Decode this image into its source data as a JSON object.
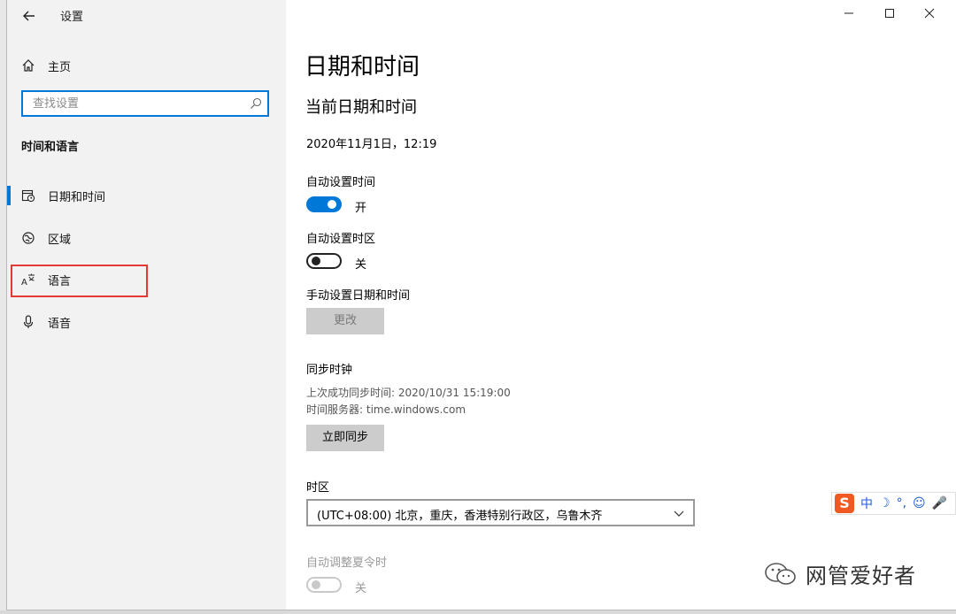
{
  "window": {
    "app_title": "设置",
    "controls": {
      "minimize": "—",
      "maximize": "☐",
      "close": "✕"
    }
  },
  "sidebar": {
    "home_label": "主页",
    "search_placeholder": "查找设置",
    "section_title": "时间和语言",
    "items": [
      {
        "label": "日期和时间",
        "icon": "calendar-clock-icon",
        "active": true
      },
      {
        "label": "区域",
        "icon": "globe-region-icon",
        "active": false
      },
      {
        "label": "语言",
        "icon": "language-icon",
        "active": false
      },
      {
        "label": "语音",
        "icon": "microphone-icon",
        "active": false
      }
    ]
  },
  "main": {
    "page_title": "日期和时间",
    "section_current": "当前日期和时间",
    "current_datetime": "2020年11月1日，12:19",
    "auto_time": {
      "label": "自动设置时间",
      "state_label": "开",
      "on": true
    },
    "auto_timezone": {
      "label": "自动设置时区",
      "state_label": "关",
      "on": false
    },
    "manual": {
      "label": "手动设置日期和时间",
      "button": "更改"
    },
    "sync": {
      "label": "同步时钟",
      "last_sync": "上次成功同步时间: 2020/10/31 15:19:00",
      "server": "时间服务器: time.windows.com",
      "button": "立即同步"
    },
    "timezone": {
      "label": "时区",
      "value": "(UTC+08:00) 北京，重庆，香港特别行政区，乌鲁木齐"
    },
    "dst": {
      "label": "自动调整夏令时",
      "state_label": "关",
      "on": false
    }
  },
  "ime": {
    "logo": "S",
    "mode": "中",
    "items": [
      "☽",
      "°,",
      "☺",
      "🎤"
    ]
  },
  "watermark": {
    "text": "网管爱好者"
  },
  "colors": {
    "accent": "#0078d7",
    "highlight": "#e53935",
    "sidebar_bg": "#f2f2f2"
  }
}
